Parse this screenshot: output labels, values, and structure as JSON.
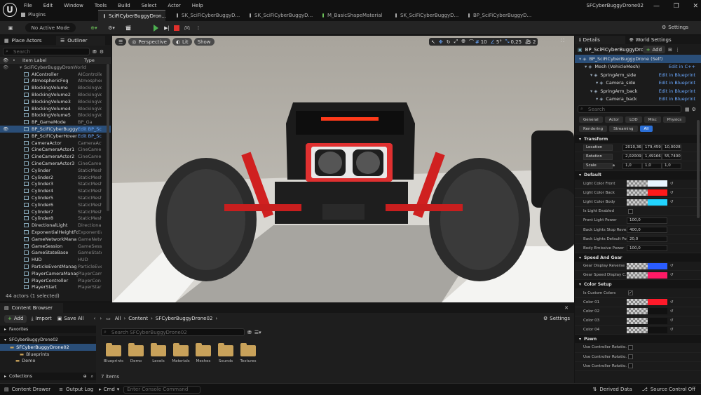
{
  "menu": [
    "File",
    "Edit",
    "Window",
    "Tools",
    "Build",
    "Select",
    "Actor",
    "Help"
  ],
  "plugins": "Plugins",
  "tabs": [
    "SciFiCyberBuggyDron...",
    "SK_SciFiCyberBuggyD...",
    "SK_SciFiCyberBuggyD...",
    "M_BasicShapeMaterial",
    "SK_SciFiCyberBuggyD...",
    "BP_SciFiCyberBuggyD..."
  ],
  "project_title": "SFCyberBuggyDrone02",
  "toolbar": {
    "mode": "No Active Mode",
    "settings": "Settings"
  },
  "outliner": {
    "place_actors": "Place Actors",
    "outliner": "Outliner",
    "search_placeholder": "Search",
    "col_label": "Item Label",
    "col_type": "Type",
    "root": "SciFiCyberBuggyDrone",
    "root_type": "World",
    "rows": [
      [
        "AIController",
        "AIControlle"
      ],
      [
        "AtmosphericFog",
        "Atmospheri"
      ],
      [
        "BlockingVolume",
        "BlockingVol"
      ],
      [
        "BlockingVolume2",
        "BlockingVol"
      ],
      [
        "BlockingVolume3",
        "BlockingVol"
      ],
      [
        "BlockingVolume4",
        "BlockingVol"
      ],
      [
        "BlockingVolume5",
        "BlockingVol"
      ],
      [
        "BP_GameMode",
        "BP_Ga"
      ],
      [
        "BP_SciFiCyberBuggy",
        "Edit BP_Sc"
      ],
      [
        "BP_SciFiCyberHover",
        "Edit BP_Sc"
      ],
      [
        "CameraActor",
        "CameraAct"
      ],
      [
        "CineCameraActor1",
        "CineCamer"
      ],
      [
        "CineCameraActor2",
        "CineCamer"
      ],
      [
        "CineCameraActor3",
        "CineCamer"
      ],
      [
        "Cylinder",
        "StaticMesh"
      ],
      [
        "Cylinder2",
        "StaticMesh"
      ],
      [
        "Cylinder3",
        "StaticMesh"
      ],
      [
        "Cylinder4",
        "StaticMesh"
      ],
      [
        "Cylinder5",
        "StaticMesh"
      ],
      [
        "Cylinder6",
        "StaticMesh"
      ],
      [
        "Cylinder7",
        "StaticMesh"
      ],
      [
        "Cylinder8",
        "StaticMesh"
      ],
      [
        "DirectionalLight",
        "Directiona"
      ],
      [
        "ExponentialHeightFo",
        "Exponentia"
      ],
      [
        "GameNetworkMana",
        "GameNetwo"
      ],
      [
        "GameSession",
        "GameSess"
      ],
      [
        "GameStateBase",
        "GameState"
      ],
      [
        "HUD",
        "HUD"
      ],
      [
        "ParticleEventManag",
        "ParticleEve"
      ],
      [
        "PlayerCameraManag",
        "PlayerCam"
      ],
      [
        "PlayerController",
        "PlayerCon"
      ],
      [
        "PlayerStart",
        "PlayerStar"
      ]
    ],
    "footer": "44 actors (1 selected)"
  },
  "viewport": {
    "perspective": "Perspective",
    "lit": "Lit",
    "show": "Show",
    "grid": "10",
    "angle": "5°",
    "scale": "0,25",
    "cams": "2"
  },
  "details": {
    "tab_details": "Details",
    "tab_world": "World Settings",
    "actor": "BP_SciFiCyberBuggyDro",
    "add": "Add",
    "components": [
      {
        "label": "BP_SciFiCyberBuggyDrone (Self)",
        "link": ""
      },
      {
        "label": "Mesh (VehicleMesh)",
        "link": "Edit in C++"
      },
      {
        "label": "SpringArm_side",
        "link": "Edit in Blueprint"
      },
      {
        "label": "Camera_side",
        "link": "Edit in Blueprint"
      },
      {
        "label": "SpringArm_back",
        "link": "Edit in Blueprint"
      },
      {
        "label": "Camera_back",
        "link": "Edit in Blueprint"
      }
    ],
    "search_placeholder": "Search",
    "filters1": [
      "General",
      "Actor",
      "LOD",
      "Misc",
      "Physics"
    ],
    "filters2": [
      "Rendering",
      "Streaming",
      "All"
    ],
    "transform": "Transform",
    "location": [
      "Location",
      "2010,36",
      "179,459",
      "10,0028"
    ],
    "rotation": [
      "Rotation",
      "2,02009",
      "1,49166",
      "55,7400"
    ],
    "scale": [
      "Scale",
      "1,0",
      "1,0",
      "1,0"
    ],
    "default": "Default",
    "default_rows": [
      {
        "k": "Light Color Front",
        "kind": "color",
        "c": "#e8f4ff"
      },
      {
        "k": "Light Color Back",
        "kind": "color",
        "c": "#ff1a1a"
      },
      {
        "k": "Light Color Body",
        "kind": "color",
        "c": "#22d4ff"
      },
      {
        "k": "Is Light Enabled",
        "kind": "check",
        "v": ""
      },
      {
        "k": "Front Light Power",
        "kind": "num",
        "v": "100,0"
      },
      {
        "k": "Back Lights Stop Reve...",
        "kind": "num",
        "v": "400,0"
      },
      {
        "k": "Back Lights Default Po...",
        "kind": "num",
        "v": "20,0"
      },
      {
        "k": "Body Emissive Power",
        "kind": "num",
        "v": "100,0"
      }
    ],
    "speed": "Speed And Gear",
    "speed_rows": [
      {
        "k": "Gear Display Reverse ...",
        "c": "#2a5cff"
      },
      {
        "k": "Gear Speed Display C...",
        "c": "#ff1a66"
      }
    ],
    "colorsetup": "Color Setup",
    "color_rows": [
      {
        "k": "Is Custom Colors",
        "kind": "check",
        "v": "✓"
      },
      {
        "k": "Color 01",
        "kind": "color",
        "c": "#ff1a2a"
      },
      {
        "k": "Color 02",
        "kind": "color",
        "c": "#111111"
      },
      {
        "k": "Color 03",
        "kind": "color",
        "c": "#111111"
      },
      {
        "k": "Color 04",
        "kind": "color",
        "c": "#111111"
      }
    ],
    "pawn": "Pawn",
    "pawn_rows": [
      "Use Controller Rotatio...",
      "Use Controller Rotatio...",
      "Use Controller Rotatio..."
    ]
  },
  "content_browser": {
    "tab": "Content Browser",
    "add": "Add",
    "import": "Import",
    "save_all": "Save All",
    "path": [
      "All",
      "Content",
      "SFCyberBuggyDrone02"
    ],
    "settings": "Settings",
    "favorites": "Favorites",
    "root": "SFCyberBuggyDrone02",
    "tree": [
      "SFCyberBuggyDrone02",
      "Blueprints",
      "Demo"
    ],
    "collections": "Collections",
    "search_placeholder": "Search SFCyberBuggyDrone02",
    "folders": [
      "Blueprints",
      "Demo",
      "Levels",
      "Materials",
      "Meshes",
      "Sounds",
      "Textures"
    ],
    "count": "7 items"
  },
  "status": {
    "drawer": "Content Drawer",
    "output": "Output Log",
    "cmd": "Cmd",
    "console_placeholder": "Enter Console Command",
    "derived": "Derived Data",
    "source": "Source Control Off"
  }
}
